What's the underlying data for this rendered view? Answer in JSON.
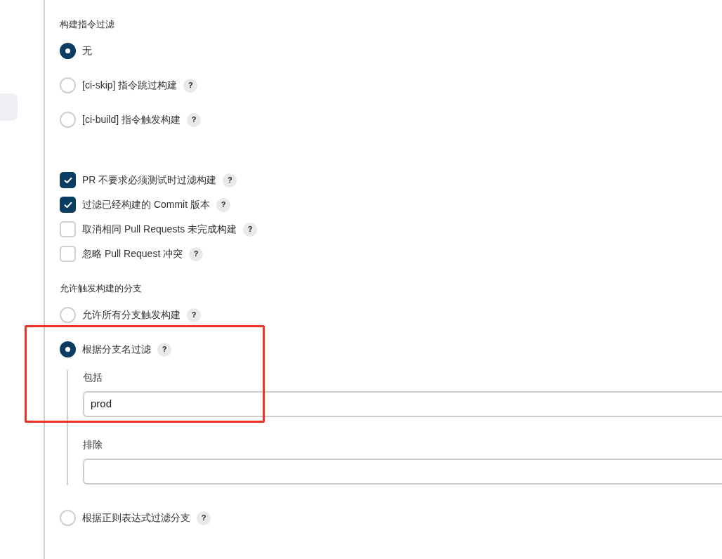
{
  "sections": [
    {
      "kind": "radio_group",
      "title": "构建指令过滤",
      "options": [
        {
          "label": "无",
          "selected": true
        },
        {
          "label": "[ci-skip] 指令跳过构建",
          "selected": false,
          "help": "?"
        },
        {
          "label": "[ci-build] 指令触发构建",
          "selected": false,
          "help": "?"
        }
      ]
    },
    {
      "kind": "checkbox_group",
      "options": [
        {
          "label": "PR 不要求必须测试时过滤构建",
          "checked": true,
          "help": "?"
        },
        {
          "label": "过滤已经构建的 Commit 版本",
          "checked": true,
          "help": "?"
        },
        {
          "label": "取消相同 Pull Requests 未完成构建",
          "checked": false,
          "help": "?"
        },
        {
          "label": "忽略 Pull Request 冲突",
          "checked": false,
          "help": "?"
        }
      ]
    },
    {
      "kind": "radio_group",
      "title": "允许触发构建的分支",
      "options": [
        {
          "label": "允许所有分支触发构建",
          "selected": false,
          "help": "?"
        },
        {
          "label": "根据分支名过滤",
          "selected": true,
          "help": "?",
          "fields": [
            {
              "label": "包括",
              "value": "prod"
            },
            {
              "label": "排除"
            }
          ]
        },
        {
          "label": "根据正则表达式过滤分支",
          "selected": false,
          "help": "?"
        }
      ]
    }
  ]
}
